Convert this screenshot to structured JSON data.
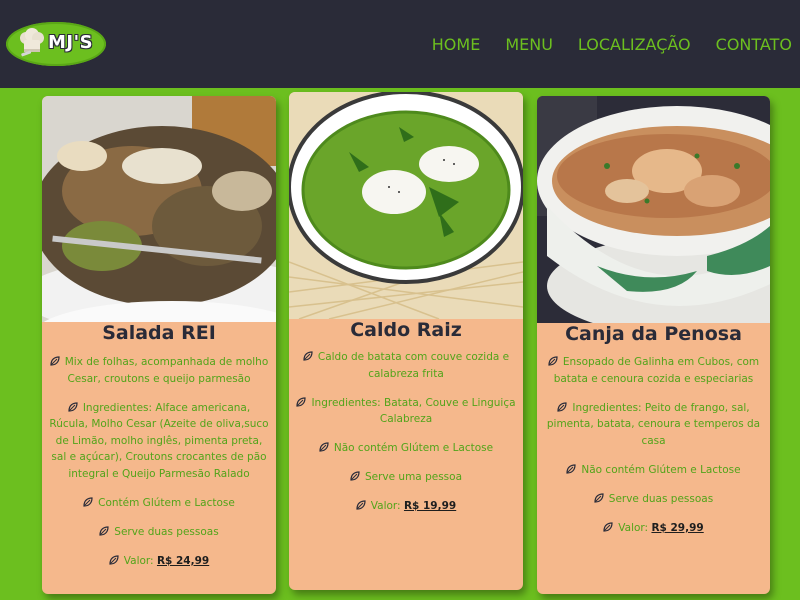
{
  "brand": {
    "logo_text": "MJ'S"
  },
  "nav": {
    "items": [
      {
        "label": "HOME"
      },
      {
        "label": "MENU"
      },
      {
        "label": "LOCALIZAÇÃO"
      },
      {
        "label": "CONTATO"
      }
    ]
  },
  "colors": {
    "header_bg": "#2a2b38",
    "accent_green": "#6cbf1f",
    "card_bg": "#f5b88c"
  },
  "cards": [
    {
      "title": "Salada REI",
      "description": "Mix de folhas, acompanhada de molho Cesar, croutons e queijo parmesão",
      "ingredients": "Ingredientes: Alface americana, Rúcula, Molho Cesar (Azeite de oliva,suco de Limão, molho inglês, pimenta preta, sal e açúcar), Croutons crocantes de pão integral e Queijo Parmesão Ralado",
      "allergens": "Contém Glútem e Lactose",
      "serves": "Serve duas pessoas",
      "price_label": "Valor:",
      "price": "R$ 24,99",
      "image": "salad-photo"
    },
    {
      "title": "Caldo Raiz",
      "description": "Caldo de batata com couve cozida e calabreza frita",
      "ingredients": "Ingredientes: Batata, Couve e Linguiça Calabreza",
      "allergens": "Não contém Glútem e Lactose",
      "serves": "Serve uma pessoa",
      "price_label": "Valor:",
      "price": "R$ 19,99",
      "image": "green-soup-photo"
    },
    {
      "title": "Canja da Penosa",
      "description": "Ensopado de Galinha em Cubos, com batata e cenoura cozida e especiarias",
      "ingredients": "Ingredientes: Peito de frango, sal, pimenta, batata, cenoura e temperos da casa",
      "allergens": "Não contém Glútem e Lactose",
      "serves": "Serve duas pessoas",
      "price_label": "Valor:",
      "price": "R$ 29,99",
      "image": "chicken-soup-photo"
    }
  ]
}
